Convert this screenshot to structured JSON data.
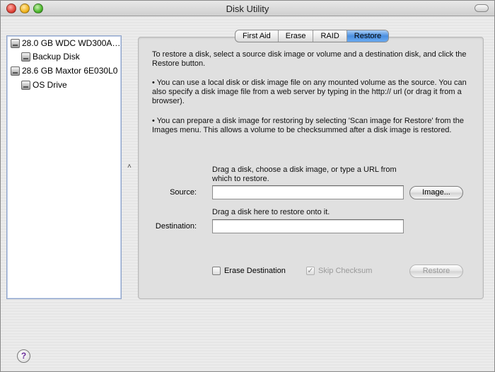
{
  "window": {
    "title": "Disk Utility"
  },
  "sidebar": {
    "items": [
      {
        "label": "28.0 GB WDC WD300A…",
        "icon": "hard-disk-icon"
      },
      {
        "label": "Backup Disk",
        "icon": "volume-icon"
      },
      {
        "label": "28.6 GB Maxtor 6E030L0",
        "icon": "hard-disk-icon"
      },
      {
        "label": "OS Drive",
        "icon": "volume-icon"
      }
    ],
    "selected_index": 3
  },
  "tabs": [
    {
      "label": "First Aid"
    },
    {
      "label": "Erase"
    },
    {
      "label": "RAID"
    },
    {
      "label": "Restore"
    }
  ],
  "active_tab": "Restore",
  "restore": {
    "intro": "To restore a disk, select a source disk image or volume and a destination disk, and click the Restore button.",
    "bullet1": "• You can use a local disk or disk image file on any mounted volume as the source. You can also specify a disk image file from a web server by typing in the http:// url (or drag it from a browser).",
    "bullet2": "• You can prepare a disk image for restoring by selecting 'Scan image for Restore' from the Images menu. This allows a volume to be checksummed after a disk image is restored.",
    "source_hint": "Drag a disk, choose a disk image, or type a URL from which to restore.",
    "source_label": "Source:",
    "source_value": "",
    "image_button": "Image...",
    "destination_hint": "Drag a disk here to restore onto it.",
    "destination_label": "Destination:",
    "destination_value": "",
    "erase_destination_label": "Erase Destination",
    "erase_destination_checked": false,
    "skip_checksum_label": "Skip Checksum",
    "skip_checksum_checked": true,
    "restore_button": "Restore"
  },
  "glyphs": {
    "check": "✓",
    "help": "?",
    "splitter": "˄"
  }
}
